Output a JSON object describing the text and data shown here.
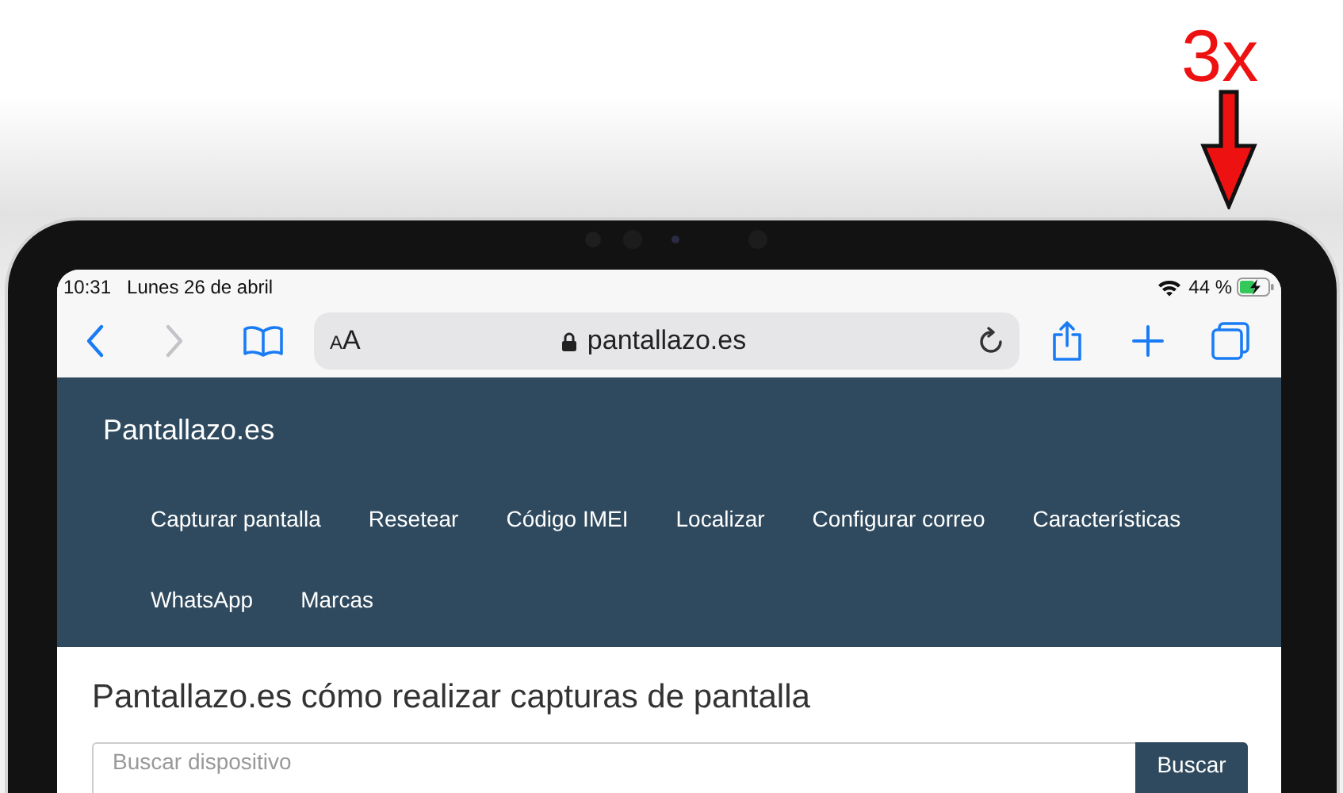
{
  "annotation": {
    "label": "3x"
  },
  "status_bar": {
    "time": "10:31",
    "date": "Lunes 26 de abril",
    "battery": "44 %",
    "charging": true
  },
  "browser": {
    "back_enabled": true,
    "forward_enabled": false,
    "text_size": "AA",
    "url": "pantallazo.es",
    "secure": true
  },
  "site": {
    "title": "Pantallazo.es",
    "nav": [
      "Capturar pantalla",
      "Resetear",
      "Código IMEI",
      "Localizar",
      "Configurar correo",
      "Características",
      "WhatsApp",
      "Marcas"
    ],
    "heading": "Pantallazo.es cómo realizar capturas de pantalla",
    "search": {
      "placeholder": "Buscar dispositivo",
      "button": "Buscar"
    }
  }
}
